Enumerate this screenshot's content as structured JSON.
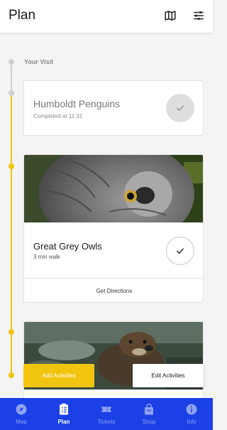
{
  "header": {
    "title": "Plan",
    "map_icon": "map-icon",
    "filter_icon": "sliders-icon"
  },
  "timeline": {
    "section_label": "Your Visit"
  },
  "visits": [
    {
      "name": "Humboldt Penguins",
      "status": "Completed at 11:31",
      "completed": true
    },
    {
      "name": "Great Grey Owls",
      "status": "3 min walk",
      "completed": false,
      "directions_label": "Get Directions",
      "image_icon": "owl-photo"
    },
    {
      "image_icon": "otter-photo"
    }
  ],
  "actions": {
    "add_label": "Add Activities",
    "edit_label": "Edit Activities"
  },
  "bottom_nav": {
    "items": [
      {
        "label": "Map",
        "icon": "compass-icon"
      },
      {
        "label": "Plan",
        "icon": "clipboard-icon"
      },
      {
        "label": "Tickets",
        "icon": "ticket-icon"
      },
      {
        "label": "Shop",
        "icon": "bag-icon"
      },
      {
        "label": "Info",
        "icon": "info-icon"
      }
    ],
    "active": "Plan"
  },
  "colors": {
    "accent": "#f1c40f",
    "nav_bg": "#1a40e6",
    "nav_active": "#ffffff",
    "nav_inactive": "#8fa2f2"
  }
}
